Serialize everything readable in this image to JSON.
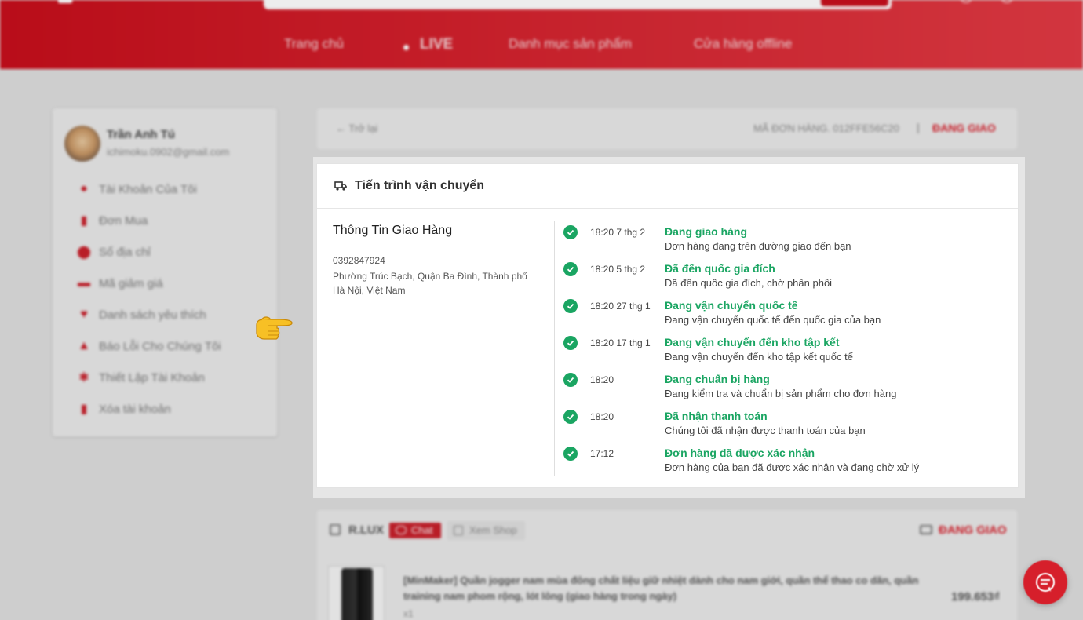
{
  "header": {
    "nav": [
      "Trang chủ",
      "LIVE",
      "Danh mục sản phẩm",
      "Cửa hàng offline"
    ]
  },
  "profile": {
    "name": "Trần Anh Tú",
    "email": "ichimoku.0902@gmail.com",
    "menu": [
      {
        "label": "Tài Khoản Của Tôi",
        "icon": "user-icon"
      },
      {
        "label": "Đơn Mua",
        "icon": "document-icon"
      },
      {
        "label": "Sổ địa chỉ",
        "icon": "location-pin-icon"
      },
      {
        "label": "Mã giảm giá",
        "icon": "ticket-icon"
      },
      {
        "label": "Danh sách yêu thích",
        "icon": "heart-icon"
      },
      {
        "label": "Báo Lỗi Cho Chúng Tôi",
        "icon": "warning-icon"
      },
      {
        "label": "Thiết Lập Tài Khoản",
        "icon": "settings-icon"
      },
      {
        "label": "Xóa tài khoản",
        "icon": "trash-icon"
      }
    ]
  },
  "order": {
    "back_label": "Trở lại",
    "code_label": "MÃ ĐƠN HÀNG. 012FFE56C20",
    "separator": "|",
    "status": "ĐANG GIAO"
  },
  "modal": {
    "title": "Tiến trình vận chuyển",
    "shipping_title": "Thông Tin Giao Hàng",
    "phone": "0392847924",
    "address": "Phường Trúc Bạch, Quận Ba Đình, Thành phố Hà Nội, Việt Nam",
    "steps": [
      {
        "time": "18:20 7 thg 2",
        "title": "Đang giao hàng",
        "desc": "Đơn hàng đang trên đường giao đến bạn"
      },
      {
        "time": "18:20 5 thg 2",
        "title": "Đã đến quốc gia đích",
        "desc": "Đã đến quốc gia đích, chờ phân phối"
      },
      {
        "time": "18:20 27 thg 1",
        "title": "Đang vận chuyển quốc tế",
        "desc": "Đang vận chuyển quốc tế đến quốc gia của bạn"
      },
      {
        "time": "18:20 17 thg 1",
        "title": "Đang vận chuyển đến kho tập kết",
        "desc": "Đang vận chuyển đến kho tập kết quốc tế"
      },
      {
        "time": "18:20",
        "title": "Đang chuẩn bị hàng",
        "desc": "Đang kiểm tra và chuẩn bị sản phẩm cho đơn hàng"
      },
      {
        "time": "18:20",
        "title": "Đã nhận thanh toán",
        "desc": "Chúng tôi đã nhận được thanh toán của bạn"
      },
      {
        "time": "17:12",
        "title": "Đơn hàng đã được xác nhận",
        "desc": "Đơn hàng của bạn đã được xác nhận và đang chờ xử lý"
      }
    ]
  },
  "shop": {
    "name": "R.LUX",
    "chat_label": "Chat",
    "view_shop_label": "Xem Shop",
    "status": "ĐANG GIAO",
    "product": {
      "name": "[MinMaker] Quần jogger nam mùa đông chất liệu giữ nhiệt dành cho nam giới, quần thể thao co dãn, quần training nam phom rộng, lót lông (giao hàng trong ngày)",
      "qty": "x1",
      "price": "199.653₫"
    }
  },
  "colors": {
    "brand_red": "#d61f2b",
    "success_green": "#1aa562"
  }
}
